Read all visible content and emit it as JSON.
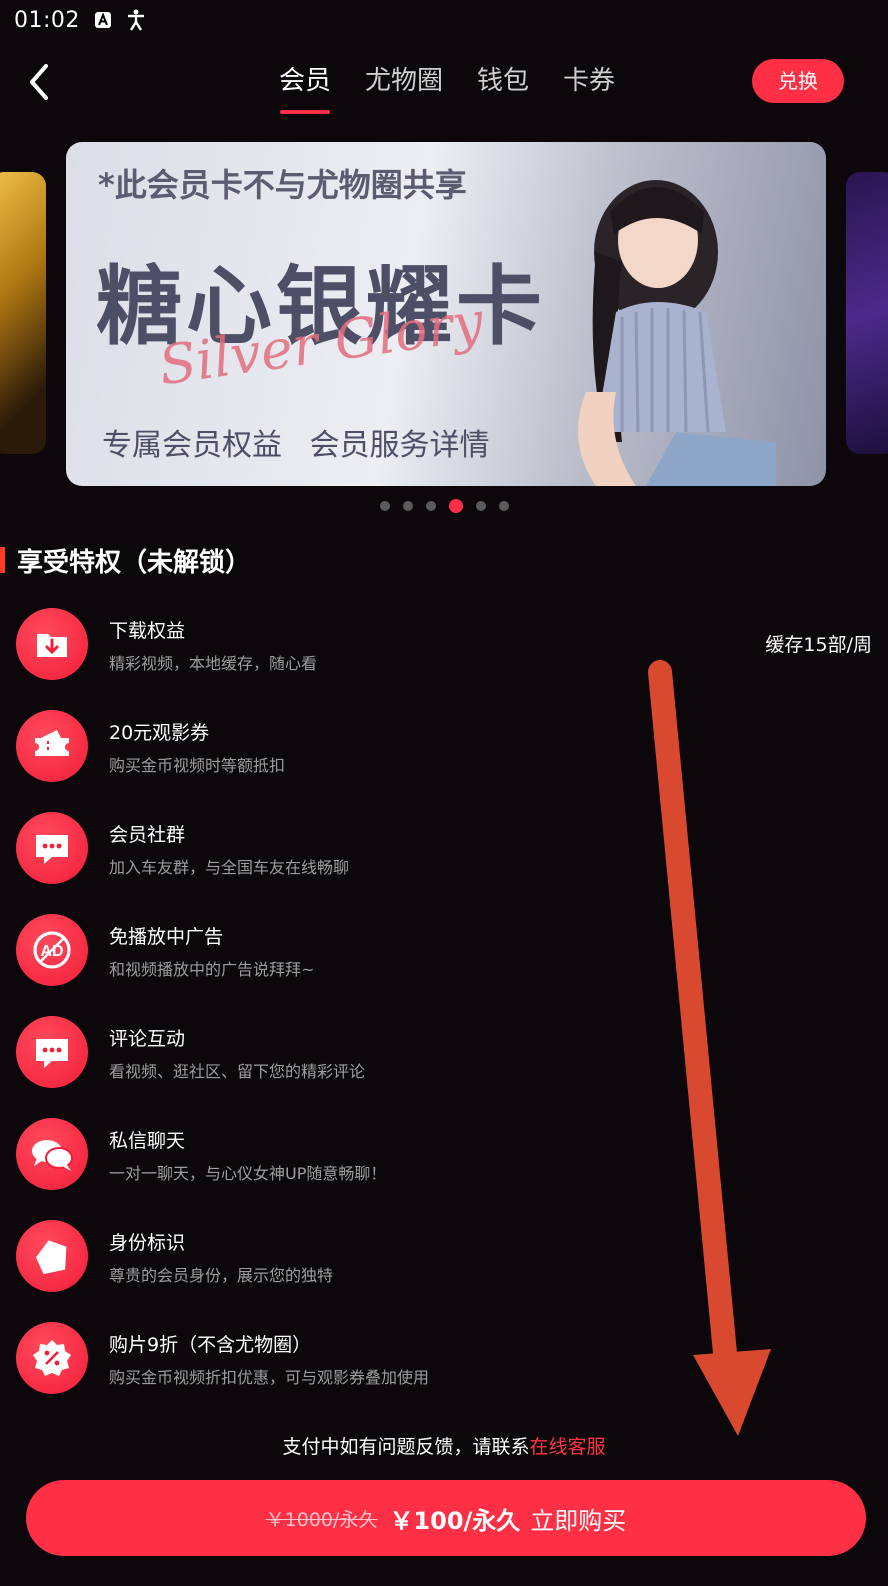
{
  "status_bar": {
    "time": "01:02",
    "icons": [
      "a-icon",
      "accessibility-icon"
    ]
  },
  "nav": {
    "back_icon": "chevron-left-icon",
    "tabs": [
      {
        "label": "会员",
        "active": true
      },
      {
        "label": "尤物圈",
        "active": false
      },
      {
        "label": "钱包",
        "active": false
      },
      {
        "label": "卡券",
        "active": false
      }
    ],
    "redeem_label": "兑换"
  },
  "banner": {
    "notice": "*此会员卡不与尤物圈共享",
    "card_name": "糖心银耀卡",
    "script_text": "Silver Glory",
    "perk_link_1": "专属会员权益",
    "perk_link_2": "会员服务详情",
    "dots_total": 6,
    "active_dot": 4
  },
  "section": {
    "title": "享受特权（未解锁）"
  },
  "perks": [
    {
      "icon": "download-folder-icon",
      "name": "下载权益",
      "desc": "精彩视频，本地缓存，随心看",
      "extra": "缓存15部/周"
    },
    {
      "icon": "ticket-icon",
      "name": "20元观影券",
      "desc": "购买金币视频时等额抵扣",
      "extra": ""
    },
    {
      "icon": "chat-bubble-icon",
      "name": "会员社群",
      "desc": "加入车友群，与全国车友在线畅聊",
      "extra": ""
    },
    {
      "icon": "no-ads-icon",
      "name": "免播放中广告",
      "desc": "和视频播放中的广告说拜拜~",
      "extra": ""
    },
    {
      "icon": "comment-icon",
      "name": "评论互动",
      "desc": "看视频、逛社区、留下您的精彩评论",
      "extra": ""
    },
    {
      "icon": "private-message-icon",
      "name": "私信聊天",
      "desc": "一对一聊天，与心仪女神UP随意畅聊！",
      "extra": ""
    },
    {
      "icon": "identity-badge-icon",
      "name": "身份标识",
      "desc": "尊贵的会员身份，展示您的独特",
      "extra": ""
    },
    {
      "icon": "discount-icon",
      "name": "购片9折（不含尤物圈）",
      "desc": "购买金币视频折扣优惠，可与观影券叠加使用",
      "extra": ""
    }
  ],
  "support": {
    "text": "支付中如有问题反馈，请联系",
    "link": "在线客服"
  },
  "buy": {
    "old_price": "￥1000/永久",
    "price": "￥100/永久",
    "cta": "立即购买"
  },
  "colors": {
    "accent": "#ff2f45",
    "background": "#0b070a",
    "annotation_arrow": "#d9492f"
  }
}
